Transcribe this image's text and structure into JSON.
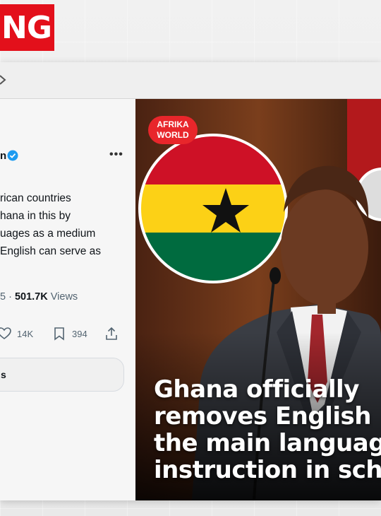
{
  "badge": {
    "text": "NG"
  },
  "tweet": {
    "author_fragment": "n",
    "more_label": "•••",
    "text_lines": [
      "rican countries",
      "hana in this by",
      "uages as a medium",
      " English can serve as"
    ],
    "meta_prefix": "5 · ",
    "views_count": "501.7K",
    "views_label": "Views",
    "likes": "14K",
    "bookmarks": "394",
    "replies_fragment": "s"
  },
  "image": {
    "tag_line1": "AFRIKA",
    "tag_line2": "WORLD",
    "headline_lines": [
      "Ghana officially",
      "removes English",
      "the main languag",
      "instruction in sch"
    ]
  },
  "colors": {
    "badge_red": "#e3101b",
    "ghana_red": "#ce1126",
    "ghana_gold": "#fcd116",
    "ghana_green": "#006b3f",
    "verified_blue": "#1d9bf0"
  }
}
